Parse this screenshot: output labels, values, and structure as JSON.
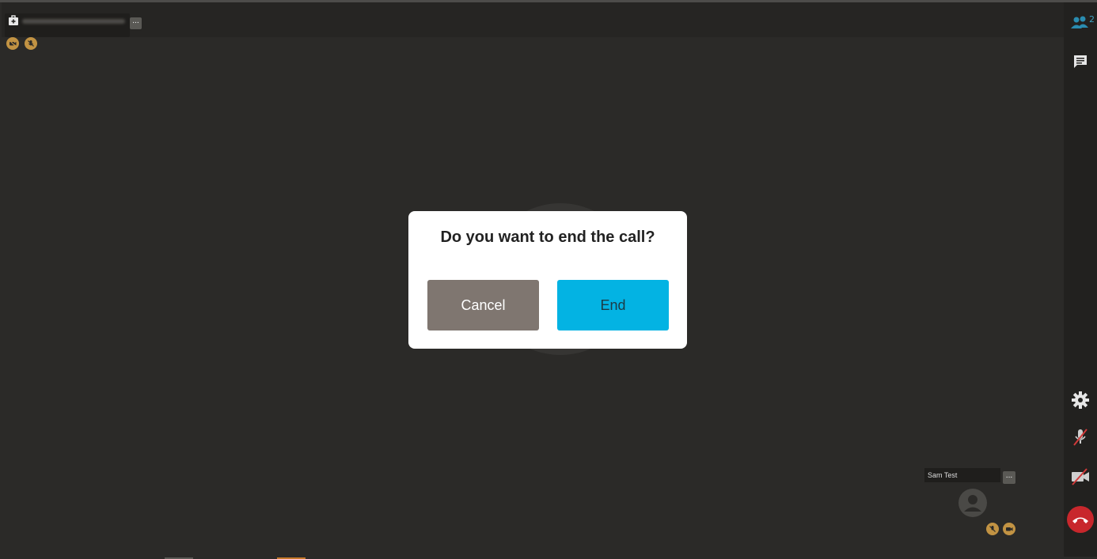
{
  "remote": {
    "name": "",
    "more_label": "..."
  },
  "sidebar": {
    "participant_count": "2"
  },
  "dialog": {
    "title": "Do you want to end the call?",
    "cancel_label": "Cancel",
    "end_label": "End"
  },
  "self_view": {
    "name": "Sam Test",
    "more_label": "..."
  },
  "colors": {
    "accent": "#03b3e3",
    "cancel": "#7f7670",
    "status": "#c29343",
    "hangup": "#c8272c",
    "participants": "#3fa0c0"
  }
}
